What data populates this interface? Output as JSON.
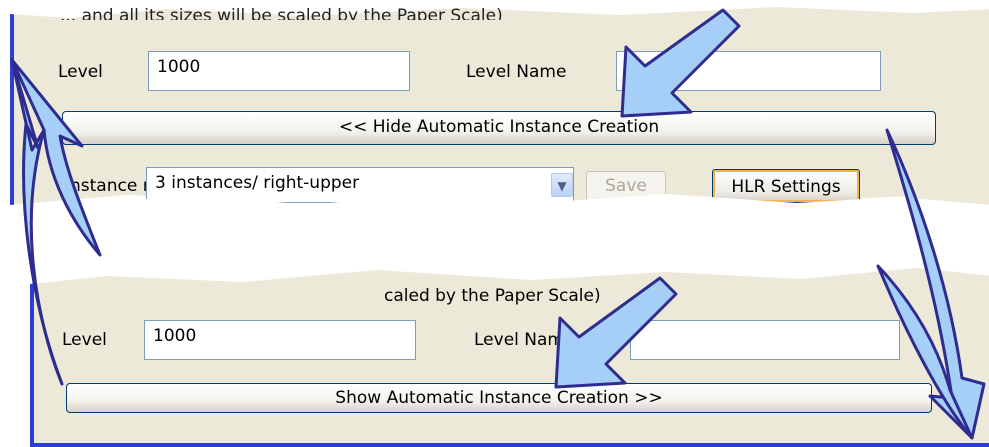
{
  "top_panel": {
    "caption_fragment": "... and all its sizes will be scaled by the Paper Scale)",
    "level_label": "Level",
    "level_value": "1000",
    "level_name_label": "Level Name",
    "level_name_value": "",
    "hide_button_label": "<< Hide Automatic Instance Creation",
    "instance_label_fragment": "Instance n",
    "instance_select_value": "3 instances/ right-upper",
    "save_label": "Save",
    "hlr_settings_label": "HLR Settings"
  },
  "bottom_panel": {
    "caption_fragment": "caled by the Paper Scale)",
    "level_label": "Level",
    "level_value": "1000",
    "level_name_label": "Level Name",
    "level_name_value": "",
    "show_button_label": "Show Automatic Instance Creation >>"
  },
  "colors": {
    "panel_background": "#ece9d8",
    "accent_border": "#2b3fd1",
    "arrow_fill": "#a6cff7",
    "arrow_outline": "#2e2c8e"
  },
  "annotations": {
    "callout_arrows": [
      "arrow-to-hide-button",
      "arrow-to-show-button"
    ],
    "transition_arrows": [
      "curved-arrow-left-up",
      "curved-arrow-right-down"
    ]
  }
}
